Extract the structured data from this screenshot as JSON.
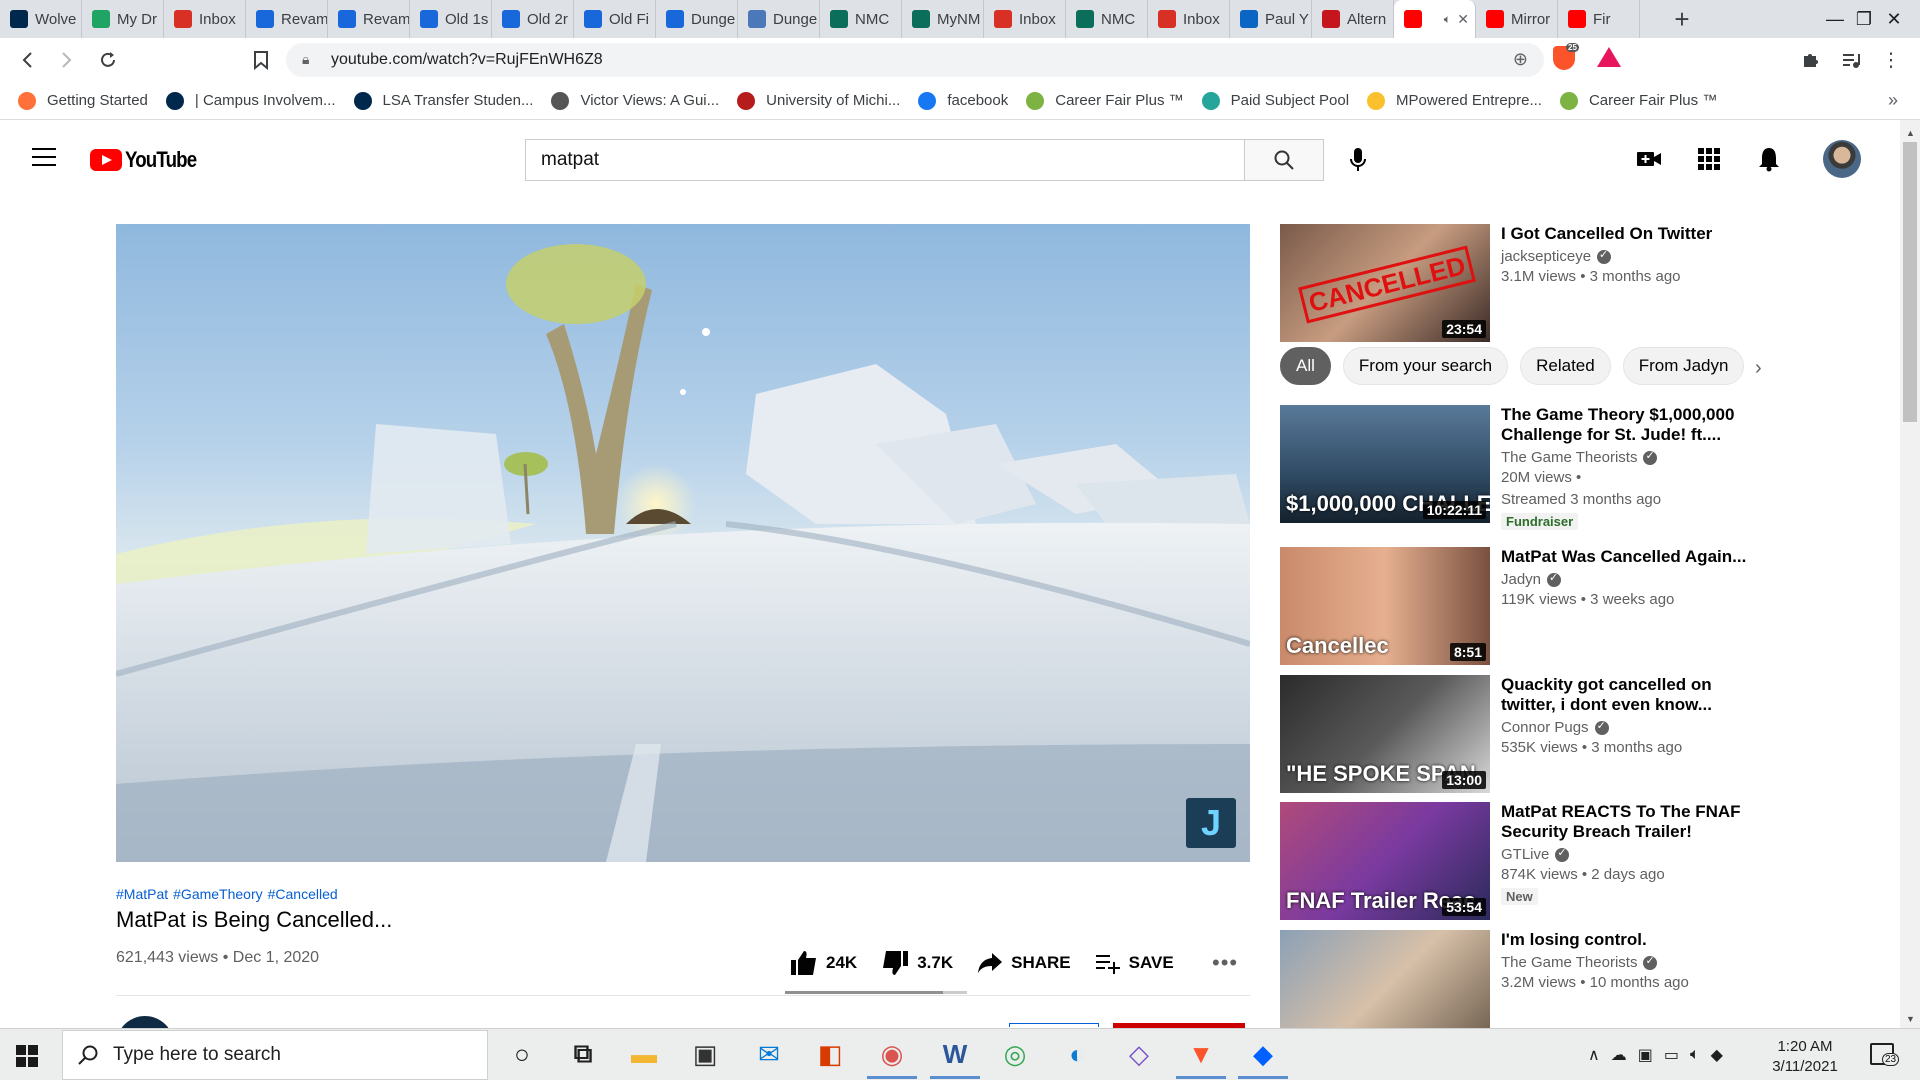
{
  "browser": {
    "tabs": [
      {
        "label": "Wolve",
        "favicon": "michigan-m-icon",
        "color": "#00274c"
      },
      {
        "label": "My Dr",
        "favicon": "google-drive-icon",
        "color": "#1fa463"
      },
      {
        "label": "Inbox",
        "favicon": "gmail-icon",
        "color": "#d93025"
      },
      {
        "label": "Revam",
        "favicon": "confluence-icon",
        "color": "#1868db"
      },
      {
        "label": "Revam",
        "favicon": "confluence-icon",
        "color": "#1868db"
      },
      {
        "label": "Old 1s",
        "favicon": "confluence-icon",
        "color": "#1868db"
      },
      {
        "label": "Old 2r",
        "favicon": "confluence-icon",
        "color": "#1868db"
      },
      {
        "label": "Old Fi",
        "favicon": "confluence-icon",
        "color": "#1868db"
      },
      {
        "label": "Dunge",
        "favicon": "confluence-icon",
        "color": "#1868db"
      },
      {
        "label": "Dunge",
        "favicon": "globe-icon",
        "color": "#4a78b8"
      },
      {
        "label": "NMC",
        "favicon": "nmc-icon",
        "color": "#0b6e5a"
      },
      {
        "label": "MyNM",
        "favicon": "nmc-icon",
        "color": "#0b6e5a"
      },
      {
        "label": "Inbox",
        "favicon": "gmail-icon",
        "color": "#d93025"
      },
      {
        "label": "NMC",
        "favicon": "nmc-icon",
        "color": "#0b6e5a"
      },
      {
        "label": "Inbox",
        "favicon": "gmail-icon",
        "color": "#d93025"
      },
      {
        "label": "Paul Y",
        "favicon": "linkedin-icon",
        "color": "#0a66c2"
      },
      {
        "label": "Altern",
        "favicon": "b-icon",
        "color": "#c4161c"
      },
      {
        "label": "",
        "favicon": "youtube-icon",
        "color": "#ff0000",
        "active": true
      },
      {
        "label": "Mirror",
        "favicon": "youtube-icon",
        "color": "#ff0000"
      },
      {
        "label": "Fir",
        "favicon": "youtube-icon",
        "color": "#ff0000"
      }
    ],
    "new_tab_symbol": "+",
    "window_buttons": {
      "minimize": "—",
      "maximize": "❐",
      "close": "✕"
    },
    "url": "youtube.com/watch?v=RujFEnWH6Z8",
    "shield_count": "25",
    "bookmarks": [
      {
        "label": "Getting Started",
        "icon": "firefox-icon",
        "color": "#ff7139"
      },
      {
        "label": "| Campus Involvem...",
        "icon": "michigan-m-icon",
        "color": "#00274c"
      },
      {
        "label": "LSA Transfer Studen...",
        "icon": "lsa-icon",
        "color": "#00274c"
      },
      {
        "label": "Victor Views: A Gui...",
        "icon": "globe-icon",
        "color": "#555555"
      },
      {
        "label": "University of Michi...",
        "icon": "umich-red-icon",
        "color": "#b71c1c"
      },
      {
        "label": "facebook",
        "icon": "facebook-icon",
        "color": "#1877f2"
      },
      {
        "label": "Career Fair Plus ™",
        "icon": "careerfair-icon",
        "color": "#7cb342"
      },
      {
        "label": "Paid Subject Pool",
        "icon": "subject-pool-icon",
        "color": "#26a69a"
      },
      {
        "label": "MPowered Entrepre...",
        "icon": "mpowered-icon",
        "color": "#fbc02d"
      },
      {
        "label": "Career Fair Plus ™",
        "icon": "careerfair-icon",
        "color": "#7cb342"
      }
    ],
    "bookmarks_more": "»"
  },
  "youtube": {
    "logo_text": "YouTube",
    "search_value": "matpat",
    "video": {
      "hashtags": [
        "#MatPat",
        "#GameTheory",
        "#Cancelled"
      ],
      "title": "MatPat is Being Cancelled...",
      "meta": "621,443 views • Dec 1, 2020",
      "likes": "24K",
      "dislikes": "3.7K",
      "share_label": "SHARE",
      "save_label": "SAVE",
      "like_ratio": 0.87,
      "watermark_letter": "J"
    },
    "chips": [
      {
        "label": "All",
        "selected": true
      },
      {
        "label": "From your search"
      },
      {
        "label": "Related"
      },
      {
        "label": "From Jadyn"
      }
    ],
    "recommendations": [
      {
        "title": "I Got Cancelled On Twitter",
        "channel": "jacksepticeye",
        "verified": true,
        "lines": [
          "3.1M views • 3 months ago"
        ],
        "duration": "23:54",
        "thumb_text": "CANCELLED"
      },
      {
        "title": "The Game Theory $1,000,000 Challenge for St. Jude! ft....",
        "channel": "The Game Theorists",
        "verified": true,
        "lines": [
          "20M views •",
          "Streamed 3 months ago"
        ],
        "badge": "Fundraiser",
        "badge_style": "green",
        "duration": "10:22:11",
        "thumb_text": "$1,000,000 CHALLE"
      },
      {
        "title": "MatPat Was Cancelled Again...",
        "channel": "Jadyn",
        "verified": true,
        "lines": [
          "119K views • 3 weeks ago"
        ],
        "duration": "8:51",
        "thumb_text": "Cancellec"
      },
      {
        "title": "Quackity got cancelled on twitter, i dont even know...",
        "channel": "Connor Pugs",
        "verified": true,
        "lines": [
          "535K views • 3 months ago"
        ],
        "duration": "13:00",
        "thumb_text": "\"HE SPOKE SPAN"
      },
      {
        "title": "MatPat REACTS To The FNAF Security Breach Trailer!",
        "channel": "GTLive",
        "verified": true,
        "lines": [
          "874K views • 2 days ago"
        ],
        "badge": "New",
        "badge_style": "grey",
        "duration": "53:54",
        "thumb_text": "FNAF Trailer Reac"
      },
      {
        "title": "I'm losing control.",
        "channel": "The Game Theorists",
        "verified": true,
        "lines": [
          "3.2M views • 10 months ago"
        ],
        "duration": "",
        "thumb_text": ""
      }
    ]
  },
  "taskbar": {
    "search_placeholder": "Type here to search",
    "time": "1:20 AM",
    "date": "3/11/2021",
    "notification_count": "23",
    "apps": [
      {
        "name": "cortana-icon",
        "glyph": "○",
        "color": "#202020"
      },
      {
        "name": "task-view-icon",
        "glyph": "⧉",
        "color": "#202020"
      },
      {
        "name": "file-explorer-icon",
        "glyph": "▬",
        "color": "#f2b632"
      },
      {
        "name": "store-icon",
        "glyph": "▣",
        "color": "#333333"
      },
      {
        "name": "mail-icon",
        "glyph": "✉",
        "color": "#0078d4"
      },
      {
        "name": "office-icon",
        "glyph": "◧",
        "color": "#d83b01"
      },
      {
        "name": "zoom-app-icon",
        "glyph": "◉",
        "color": "#d9534f"
      },
      {
        "name": "word-icon",
        "glyph": "W",
        "color": "#2b579a"
      },
      {
        "name": "chrome-icon",
        "glyph": "◎",
        "color": "#34a853"
      },
      {
        "name": "edge-icon",
        "glyph": "◐",
        "color": "#0c7cd5"
      },
      {
        "name": "visual-studio-icon",
        "glyph": "◇",
        "color": "#7b4fc8"
      },
      {
        "name": "brave-icon",
        "glyph": "▼",
        "color": "#fb542b"
      },
      {
        "name": "dropbox-icon",
        "glyph": "◆",
        "color": "#0061ff"
      }
    ]
  }
}
